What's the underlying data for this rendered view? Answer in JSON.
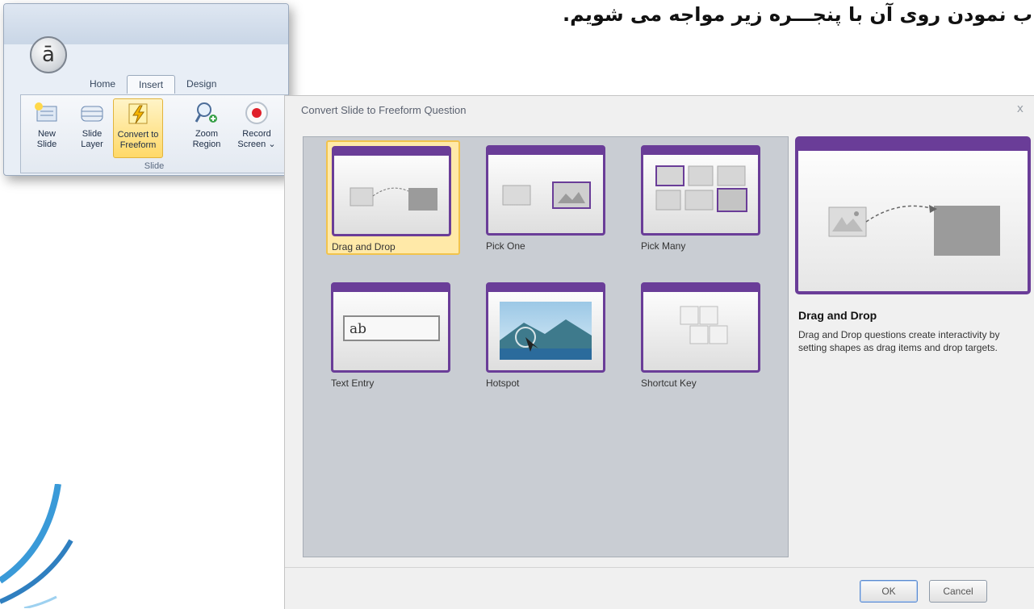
{
  "header_text": "ب نمودن روی آن با پنجـــره زیر مواجه می شویم.",
  "ribbon": {
    "app_logo": "ā",
    "tabs": [
      {
        "label": "Home",
        "active": false
      },
      {
        "label": "Insert",
        "active": true
      },
      {
        "label": "Design",
        "active": false
      }
    ],
    "buttons": [
      {
        "line1": "New",
        "line2": "Slide",
        "icon": "new-slide-icon"
      },
      {
        "line1": "Slide",
        "line2": "Layer",
        "icon": "slide-layer-icon"
      },
      {
        "line1": "Convert to",
        "line2": "Freeform",
        "icon": "lightning-icon",
        "highlighted": true
      },
      {
        "line1": "Zoom",
        "line2": "Region",
        "icon": "zoom-region-icon"
      },
      {
        "line1": "Record",
        "line2": "Screen ⌄",
        "icon": "record-icon"
      }
    ],
    "group_label": "Slide"
  },
  "dialog": {
    "title": "Convert Slide to Freeform Question",
    "close": "x",
    "tiles": [
      {
        "label": "Drag and Drop",
        "icon": "drag-drop-thumbnail",
        "selected": true
      },
      {
        "label": "Pick One",
        "icon": "pick-one-thumbnail",
        "selected": false
      },
      {
        "label": "Pick Many",
        "icon": "pick-many-thumbnail",
        "selected": false
      },
      {
        "label": "Text Entry",
        "icon": "text-entry-thumbnail",
        "selected": false,
        "sample_text": "ab"
      },
      {
        "label": "Hotspot",
        "icon": "hotspot-thumbnail",
        "selected": false
      },
      {
        "label": "Shortcut Key",
        "icon": "shortcut-key-thumbnail",
        "selected": false
      }
    ],
    "preview": {
      "title": "Drag and Drop",
      "description": "Drag and Drop questions create interactivity by setting shapes as drag items and drop targets."
    },
    "ok_label": "OK",
    "cancel_label": "Cancel"
  },
  "colors": {
    "accent_purple": "#6a3d98",
    "selection_gold": "#f2c34c",
    "record_red": "#e0202a"
  }
}
